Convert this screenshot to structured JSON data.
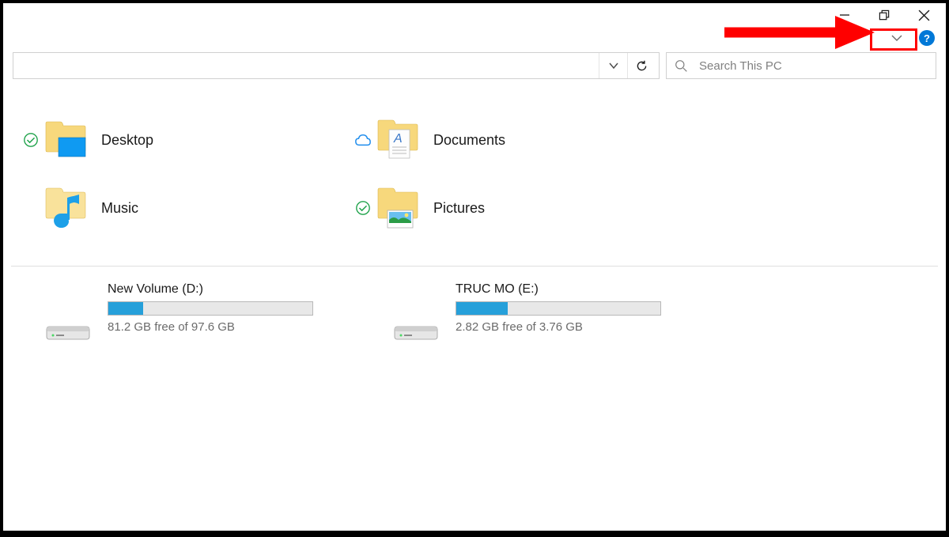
{
  "search": {
    "placeholder": "Search This PC"
  },
  "folders": [
    {
      "name": "Desktop",
      "sync": "synced",
      "icon": "desktop"
    },
    {
      "name": "Documents",
      "sync": "cloud",
      "icon": "documents"
    },
    {
      "name": "Music",
      "sync": "none",
      "icon": "music"
    },
    {
      "name": "Pictures",
      "sync": "synced",
      "icon": "pictures"
    }
  ],
  "drives": [
    {
      "name": "New Volume (D:)",
      "free_text": "81.2 GB free of 97.6 GB",
      "fill_pct": 17
    },
    {
      "name": "TRUC MO (E:)",
      "free_text": "2.82 GB free of 3.76 GB",
      "fill_pct": 25
    }
  ],
  "help_label": "?"
}
